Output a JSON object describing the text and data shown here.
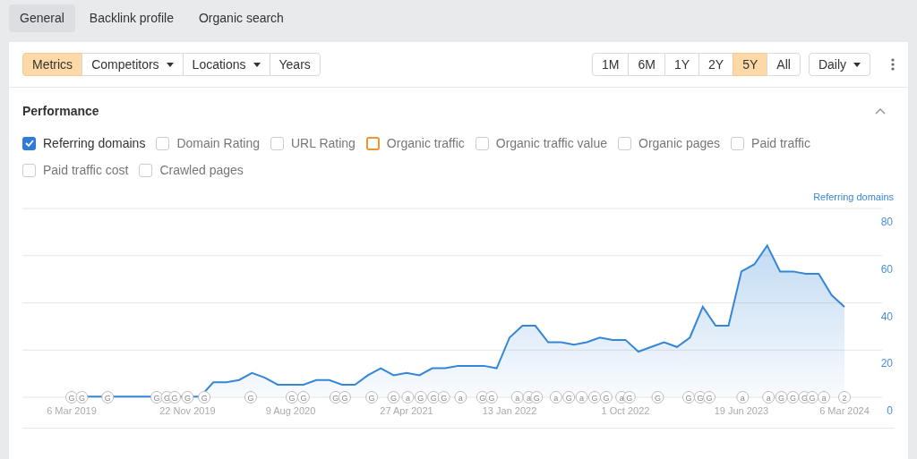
{
  "tabs": [
    {
      "label": "General",
      "selected": true
    },
    {
      "label": "Backlink profile",
      "selected": false
    },
    {
      "label": "Organic search",
      "selected": false
    }
  ],
  "toolbar": {
    "left": [
      {
        "label": "Metrics",
        "kind": "button",
        "selected": true
      },
      {
        "label": "Competitors",
        "kind": "dropdown",
        "selected": false
      },
      {
        "label": "Locations",
        "kind": "dropdown",
        "selected": false
      },
      {
        "label": "Years",
        "kind": "button",
        "selected": false
      }
    ],
    "ranges": [
      {
        "label": "1M",
        "selected": false
      },
      {
        "label": "6M",
        "selected": false
      },
      {
        "label": "1Y",
        "selected": false
      },
      {
        "label": "2Y",
        "selected": false
      },
      {
        "label": "5Y",
        "selected": true
      },
      {
        "label": "All",
        "selected": false
      }
    ],
    "interval": {
      "label": "Daily"
    }
  },
  "section": {
    "title": "Performance",
    "expanded": true
  },
  "metrics": [
    {
      "label": "Referring domains",
      "checked": true,
      "focused": false
    },
    {
      "label": "Domain Rating",
      "checked": false,
      "focused": false
    },
    {
      "label": "URL Rating",
      "checked": false,
      "focused": false
    },
    {
      "label": "Organic traffic",
      "checked": false,
      "focused": true
    },
    {
      "label": "Organic traffic value",
      "checked": false,
      "focused": false
    },
    {
      "label": "Organic pages",
      "checked": false,
      "focused": false
    },
    {
      "label": "Paid traffic",
      "checked": false,
      "focused": false
    },
    {
      "label": "Paid traffic cost",
      "checked": false,
      "focused": false
    },
    {
      "label": "Crawled pages",
      "checked": false,
      "focused": false
    }
  ],
  "chart": {
    "chart_data": {
      "type": "area",
      "categories": [
        "6 Mar 2019",
        null,
        null,
        null,
        null,
        null,
        null,
        null,
        null,
        "22 Nov 2019",
        null,
        null,
        null,
        null,
        null,
        null,
        null,
        "9 Aug 2020",
        null,
        null,
        null,
        null,
        null,
        null,
        null,
        null,
        "27 Apr 2021",
        null,
        null,
        null,
        null,
        null,
        null,
        null,
        "13 Jan 2022",
        null,
        null,
        null,
        null,
        null,
        null,
        null,
        null,
        "1 Oct 2022",
        null,
        null,
        null,
        null,
        null,
        null,
        null,
        null,
        "19 Jun 2023",
        null,
        null,
        null,
        null,
        null,
        null,
        null,
        "6 Mar 2024"
      ],
      "series": [
        {
          "name": "Referring domains",
          "color": "#3486d6",
          "values": [
            6,
            6,
            6,
            6,
            6,
            6,
            6,
            6,
            6,
            6,
            6,
            12,
            12,
            13,
            16,
            14,
            11,
            11,
            11,
            13,
            13,
            11,
            11,
            15,
            18,
            15,
            16,
            15,
            18,
            18,
            19,
            19,
            19,
            18,
            31,
            36,
            36,
            29,
            29,
            28,
            29,
            31,
            30,
            30,
            25,
            27,
            29,
            27,
            31,
            44,
            36,
            36,
            59,
            62,
            70,
            59,
            59,
            58,
            58,
            49,
            44
          ]
        }
      ],
      "ylim": [
        0,
        80
      ],
      "yticks": [
        0,
        20,
        40,
        60,
        80
      ]
    },
    "events": [
      "G",
      "G",
      "G",
      "G",
      "G",
      "G",
      "G",
      "G",
      "G",
      "G",
      "G",
      "G",
      "G",
      "G",
      "G",
      "a",
      "G",
      "G",
      "G",
      "a",
      "G",
      "G",
      "a",
      "a",
      "G",
      "a",
      "G",
      "a",
      "G",
      "G",
      "a",
      "G",
      "G",
      "G",
      "G",
      "G",
      "a",
      "a",
      "G",
      "G",
      "G",
      "G",
      "a",
      "2"
    ]
  }
}
